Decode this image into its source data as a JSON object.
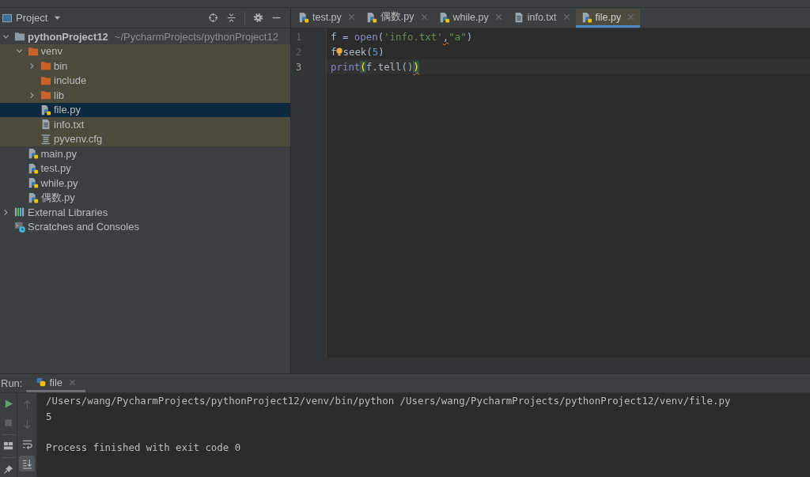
{
  "project_panel": {
    "title": "Project",
    "tree": [
      {
        "label": "pythonProject12",
        "path": "~/PycharmProjects/pythonProject12",
        "kind": "project",
        "expanded": true,
        "selected": false,
        "excluded": false,
        "children": [
          {
            "label": "venv",
            "kind": "folder",
            "expanded": true,
            "selected": false,
            "excluded": true,
            "children": [
              {
                "label": "bin",
                "kind": "folder",
                "expanded": false,
                "selected": false,
                "excluded": true
              },
              {
                "label": "include",
                "kind": "folder",
                "selected": false,
                "excluded": true
              },
              {
                "label": "lib",
                "kind": "folder",
                "expanded": false,
                "selected": false,
                "excluded": true
              },
              {
                "label": "file.py",
                "kind": "python",
                "selected": true,
                "excluded": true
              },
              {
                "label": "info.txt",
                "kind": "text",
                "selected": false,
                "excluded": true
              },
              {
                "label": "pyvenv.cfg",
                "kind": "config",
                "selected": false,
                "excluded": true
              }
            ]
          },
          {
            "label": "main.py",
            "kind": "python",
            "selected": false,
            "excluded": false
          },
          {
            "label": "test.py",
            "kind": "python",
            "selected": false,
            "excluded": false
          },
          {
            "label": "while.py",
            "kind": "python",
            "selected": false,
            "excluded": false
          },
          {
            "label": "偶数.py",
            "kind": "python",
            "selected": false,
            "excluded": false
          }
        ]
      },
      {
        "label": "External Libraries",
        "kind": "libraries",
        "expanded": false,
        "selected": false,
        "excluded": false
      },
      {
        "label": "Scratches and Consoles",
        "kind": "scratches",
        "selected": false,
        "excluded": false
      }
    ]
  },
  "editor": {
    "tabs": [
      {
        "label": "test.py",
        "kind": "python",
        "selected": false
      },
      {
        "label": "偶数.py",
        "kind": "python",
        "selected": false
      },
      {
        "label": "while.py",
        "kind": "python",
        "selected": false
      },
      {
        "label": "info.txt",
        "kind": "text",
        "selected": false
      },
      {
        "label": "file.py",
        "kind": "python",
        "selected": true
      }
    ],
    "lines": [
      {
        "number": "1",
        "current": false,
        "tokens": [
          {
            "text": "f = ",
            "kind": "plain"
          },
          {
            "text": "open",
            "kind": "builtin"
          },
          {
            "text": "(",
            "kind": "plain"
          },
          {
            "text": "'info.txt'",
            "kind": "string"
          },
          {
            "text": ",",
            "kind": "warning"
          },
          {
            "text": "\"a\"",
            "kind": "string"
          },
          {
            "text": ")",
            "kind": "plain"
          }
        ]
      },
      {
        "number": "2",
        "current": false,
        "tokens": [
          {
            "text": "f",
            "kind": "plain"
          },
          {
            "kind": "bulb"
          },
          {
            "text": "seek(",
            "kind": "plain"
          },
          {
            "text": "5",
            "kind": "number"
          },
          {
            "text": ")",
            "kind": "plain"
          }
        ]
      },
      {
        "number": "3",
        "current": true,
        "tokens": [
          {
            "text": "print",
            "kind": "builtin"
          },
          {
            "text": "(",
            "kind": "brace_match"
          },
          {
            "text": "f.tell()",
            "kind": "plain"
          },
          {
            "text": ")",
            "kind": "brace_warning"
          }
        ]
      }
    ]
  },
  "run_panel": {
    "title": "Run:",
    "tabs": [
      {
        "label": "file",
        "selected": true
      }
    ],
    "side_toolbar": [
      {
        "kind": "run",
        "disabled": false,
        "on": false
      },
      {
        "kind": "stop",
        "disabled": true,
        "on": false
      },
      {
        "kind": "layout",
        "disabled": false,
        "on": false
      },
      {
        "kind": "pin",
        "disabled": false,
        "on": false
      }
    ],
    "console_toolbar": [
      {
        "kind": "up",
        "disabled": true,
        "on": false
      },
      {
        "kind": "down",
        "disabled": true,
        "on": false
      },
      {
        "kind": "wrap",
        "disabled": false,
        "on": false
      },
      {
        "kind": "scroll_end",
        "disabled": false,
        "on": true
      }
    ],
    "console": [
      {
        "text": "/Users/wang/PycharmProjects/pythonProject12/venv/bin/python /Users/wang/PycharmProjects/pythonProject12/venv/file.py",
        "kind": "command"
      },
      {
        "text": "5",
        "kind": "output"
      },
      {
        "text": "Process finished with exit code 0",
        "kind": "exit"
      }
    ]
  }
}
